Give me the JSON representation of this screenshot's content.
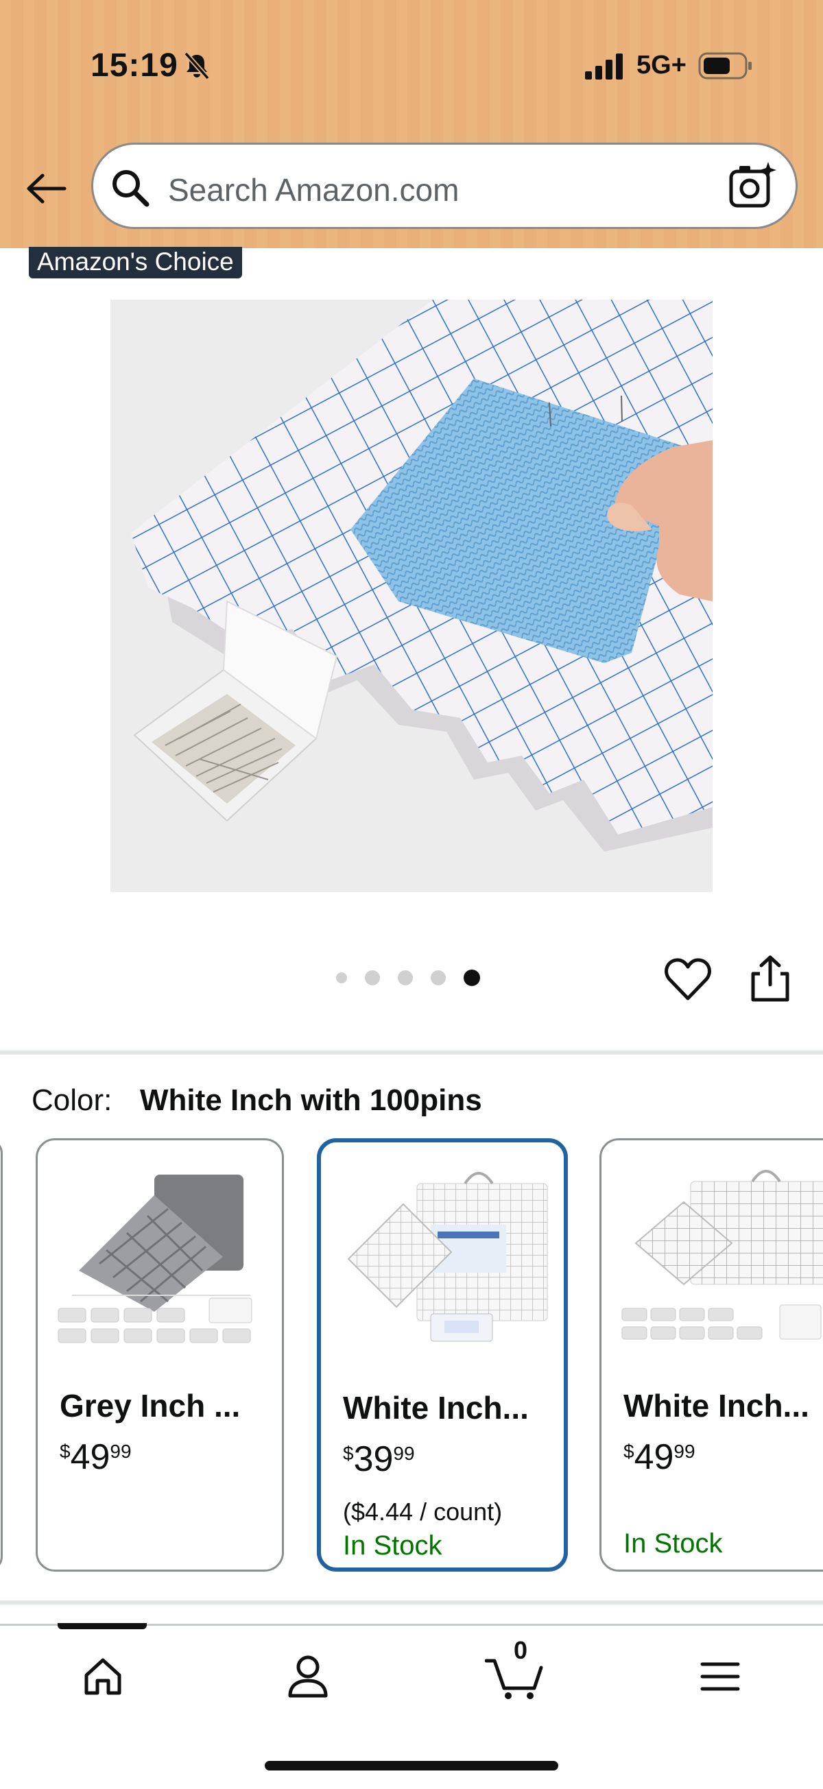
{
  "status_bar": {
    "time": "15:19",
    "network": "5G+"
  },
  "search": {
    "placeholder": "Search Amazon.com"
  },
  "badge": {
    "label": "Amazon's Choice"
  },
  "carousel": {
    "total": 5,
    "active_index": 4
  },
  "color": {
    "label": "Color:",
    "value": "White Inch with 100pins"
  },
  "variants": [
    {
      "title": "Grey Inch ...",
      "price_dollars": "49",
      "price_cents": "99",
      "currency": "$",
      "unit_price": "",
      "stock": "",
      "selected": false
    },
    {
      "title": "White Inch...",
      "price_dollars": "39",
      "price_cents": "99",
      "currency": "$",
      "unit_price": "($4.44 / count)",
      "stock": "In Stock",
      "selected": true
    },
    {
      "title": "White Inch...",
      "price_dollars": "49",
      "price_cents": "99",
      "currency": "$",
      "unit_price": "",
      "stock": "In Stock",
      "selected": false
    }
  ],
  "bottom_nav": {
    "cart_count": "0",
    "active": "home"
  },
  "colors": {
    "header_bg": "#ebb57e",
    "selected_border": "#2162a1",
    "in_stock": "#007600",
    "badge_bg": "#232f3e"
  }
}
